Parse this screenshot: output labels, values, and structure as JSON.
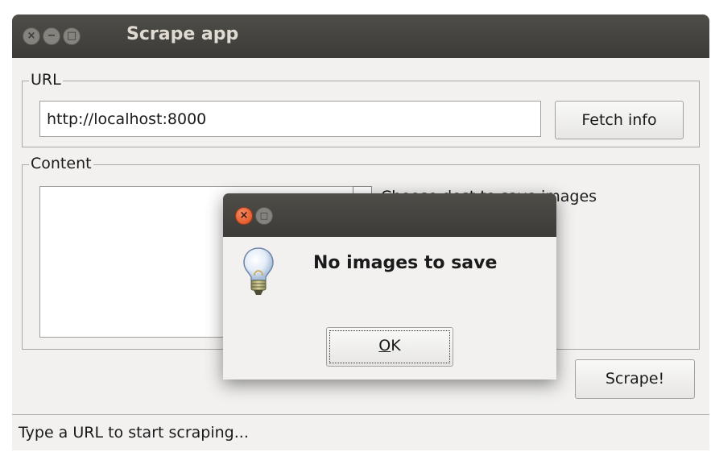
{
  "window": {
    "title": "Scrape app",
    "controls": {
      "close_glyph": "×",
      "minimize_glyph": "−",
      "maximize_glyph": "□"
    }
  },
  "url_group": {
    "legend": "URL",
    "input_value": "http://localhost:8000",
    "fetch_button": "Fetch info"
  },
  "content_group": {
    "legend": "Content",
    "save_checkbox_label": "Choose dest to save images",
    "save_checkbox_checked": false
  },
  "scrape_button": "Scrape!",
  "status_bar": {
    "text": "Type a URL to start scraping..."
  },
  "dialog": {
    "controls": {
      "close_glyph": "×",
      "maximize_glyph": "□"
    },
    "icon": "lightbulb-icon",
    "message": "No images to save",
    "ok_button": {
      "mnemonic": "O",
      "rest": "K"
    }
  },
  "colors": {
    "titlebar": "#3c3b37",
    "window_bg": "#f2f1f0",
    "close_accent": "#df4a16"
  }
}
